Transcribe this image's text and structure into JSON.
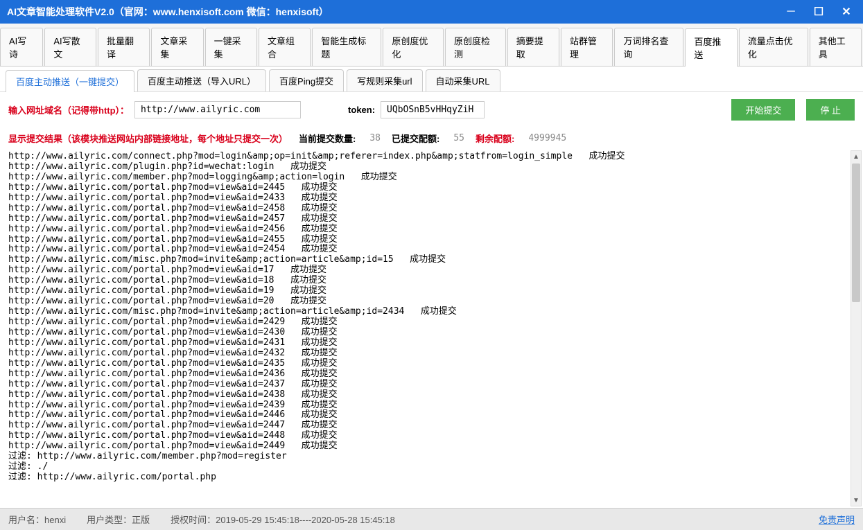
{
  "titlebar": {
    "title": "AI文章智能处理软件V2.0（官网：www.henxisoft.com  微信：henxisoft）"
  },
  "main_tabs": [
    "AI写诗",
    "AI写散文",
    "批量翻译",
    "文章采集",
    "一键采集",
    "文章组合",
    "智能生成标题",
    "原创度优化",
    "原创度检测",
    "摘要提取",
    "站群管理",
    "万词排名查询",
    "百度推送",
    "流量点击优化",
    "其他工具"
  ],
  "main_tab_active": 12,
  "sub_tabs": [
    "百度主动推送（一键提交）",
    "百度主动推送（导入URL）",
    "百度Ping提交",
    "写规则采集url",
    "自动采集URL"
  ],
  "sub_tab_active": 0,
  "controls": {
    "url_label": "输入网址域名（记得带http）：",
    "url_value": "http://www.ailyric.com",
    "token_label": "token:",
    "token_value": "UQbOSnB5vHHqyZiH",
    "btn_start": "开始提交",
    "btn_stop": "停 止"
  },
  "status": {
    "result_label": "显示提交结果（该模块推送网站内部链接地址，每个地址只提交一次）",
    "current_label": "当前提交数量:",
    "current_value": "38",
    "submitted_label": "已提交配额:",
    "submitted_value": "55",
    "remain_label": "剩余配额:",
    "remain_value": "4999945"
  },
  "log_lines": [
    "http://www.ailyric.com/connect.php?mod=login&amp;op=init&amp;referer=index.php&amp;statfrom=login_simple   成功提交",
    "http://www.ailyric.com/plugin.php?id=wechat:login   成功提交",
    "http://www.ailyric.com/member.php?mod=logging&amp;action=login   成功提交",
    "http://www.ailyric.com/portal.php?mod=view&aid=2445   成功提交",
    "http://www.ailyric.com/portal.php?mod=view&aid=2433   成功提交",
    "http://www.ailyric.com/portal.php?mod=view&aid=2458   成功提交",
    "http://www.ailyric.com/portal.php?mod=view&aid=2457   成功提交",
    "http://www.ailyric.com/portal.php?mod=view&aid=2456   成功提交",
    "http://www.ailyric.com/portal.php?mod=view&aid=2455   成功提交",
    "http://www.ailyric.com/portal.php?mod=view&aid=2454   成功提交",
    "http://www.ailyric.com/misc.php?mod=invite&amp;action=article&amp;id=15   成功提交",
    "http://www.ailyric.com/portal.php?mod=view&aid=17   成功提交",
    "http://www.ailyric.com/portal.php?mod=view&aid=18   成功提交",
    "http://www.ailyric.com/portal.php?mod=view&aid=19   成功提交",
    "http://www.ailyric.com/portal.php?mod=view&aid=20   成功提交",
    "http://www.ailyric.com/misc.php?mod=invite&amp;action=article&amp;id=2434   成功提交",
    "http://www.ailyric.com/portal.php?mod=view&aid=2429   成功提交",
    "http://www.ailyric.com/portal.php?mod=view&aid=2430   成功提交",
    "http://www.ailyric.com/portal.php?mod=view&aid=2431   成功提交",
    "http://www.ailyric.com/portal.php?mod=view&aid=2432   成功提交",
    "http://www.ailyric.com/portal.php?mod=view&aid=2435   成功提交",
    "http://www.ailyric.com/portal.php?mod=view&aid=2436   成功提交",
    "http://www.ailyric.com/portal.php?mod=view&aid=2437   成功提交",
    "http://www.ailyric.com/portal.php?mod=view&aid=2438   成功提交",
    "http://www.ailyric.com/portal.php?mod=view&aid=2439   成功提交",
    "http://www.ailyric.com/portal.php?mod=view&aid=2446   成功提交",
    "http://www.ailyric.com/portal.php?mod=view&aid=2447   成功提交",
    "http://www.ailyric.com/portal.php?mod=view&aid=2448   成功提交",
    "http://www.ailyric.com/portal.php?mod=view&aid=2449   成功提交",
    "",
    "过滤: http://www.ailyric.com/member.php?mod=register",
    "过滤: ./",
    "过滤: http://www.ailyric.com/portal.php"
  ],
  "footer": {
    "user_label": "用户名：",
    "user_value": "henxi",
    "type_label": "用户类型：",
    "type_value": "正版",
    "auth_label": "授权时间：",
    "auth_value": "2019-05-29 15:45:18----2020-05-28 15:45:18",
    "disclaimer": "免责声明"
  }
}
